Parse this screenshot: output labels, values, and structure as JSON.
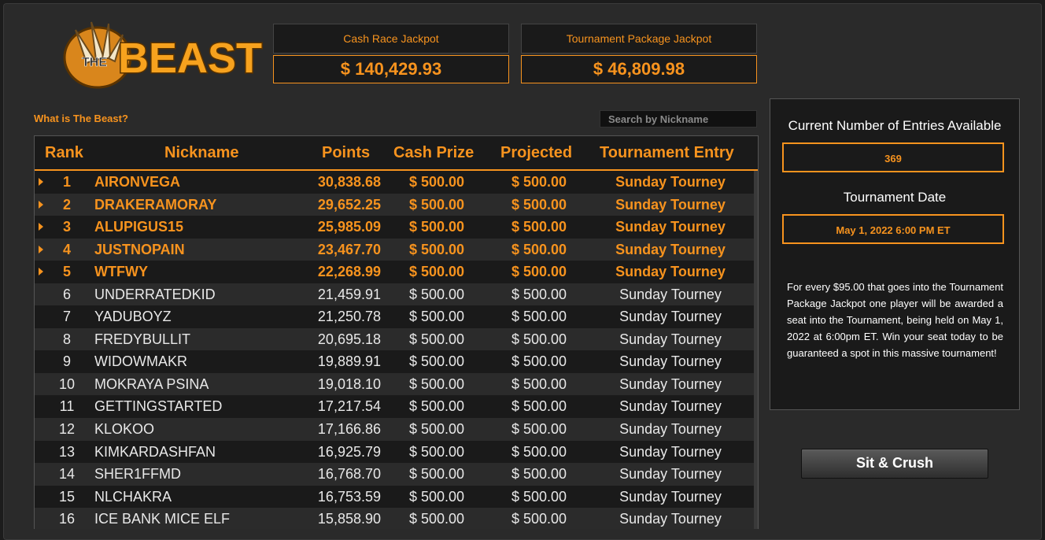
{
  "logo": {
    "text": "BEAST",
    "prefix": "THE"
  },
  "jackpots": [
    {
      "title": "Cash Race Jackpot",
      "value": "$ 140,429.93"
    },
    {
      "title": "Tournament Package Jackpot",
      "value": "$ 46,809.98"
    }
  ],
  "what_link": "What is The Beast?",
  "search": {
    "placeholder": "Search by Nickname"
  },
  "table": {
    "headers": {
      "rank": "Rank",
      "nickname": "Nickname",
      "points": "Points",
      "cash": "Cash Prize",
      "projected": "Projected",
      "tournament": "Tournament Entry"
    },
    "rows": [
      {
        "rank": "1",
        "nick": "AIRONVEGA",
        "points": "30,838.68",
        "cash": "$ 500.00",
        "proj": "$ 500.00",
        "tour": "Sunday Tourney"
      },
      {
        "rank": "2",
        "nick": "DRAKERAMORAY",
        "points": "29,652.25",
        "cash": "$ 500.00",
        "proj": "$ 500.00",
        "tour": "Sunday Tourney"
      },
      {
        "rank": "3",
        "nick": "ALUPIGUS15",
        "points": "25,985.09",
        "cash": "$ 500.00",
        "proj": "$ 500.00",
        "tour": "Sunday Tourney"
      },
      {
        "rank": "4",
        "nick": "JUSTNOPAIN",
        "points": "23,467.70",
        "cash": "$ 500.00",
        "proj": "$ 500.00",
        "tour": "Sunday Tourney"
      },
      {
        "rank": "5",
        "nick": "WTFWY",
        "points": "22,268.99",
        "cash": "$ 500.00",
        "proj": "$ 500.00",
        "tour": "Sunday Tourney"
      },
      {
        "rank": "6",
        "nick": "UNDERRATEDKID",
        "points": "21,459.91",
        "cash": "$ 500.00",
        "proj": "$ 500.00",
        "tour": "Sunday Tourney"
      },
      {
        "rank": "7",
        "nick": "YADUBOYZ",
        "points": "21,250.78",
        "cash": "$ 500.00",
        "proj": "$ 500.00",
        "tour": "Sunday Tourney"
      },
      {
        "rank": "8",
        "nick": "FREDYBULLIT",
        "points": "20,695.18",
        "cash": "$ 500.00",
        "proj": "$ 500.00",
        "tour": "Sunday Tourney"
      },
      {
        "rank": "9",
        "nick": "WIDOWMAKR",
        "points": "19,889.91",
        "cash": "$ 500.00",
        "proj": "$ 500.00",
        "tour": "Sunday Tourney"
      },
      {
        "rank": "10",
        "nick": "MOKRAYA PSINA",
        "points": "19,018.10",
        "cash": "$ 500.00",
        "proj": "$ 500.00",
        "tour": "Sunday Tourney"
      },
      {
        "rank": "11",
        "nick": "GETTINGSTARTED",
        "points": "17,217.54",
        "cash": "$ 500.00",
        "proj": "$ 500.00",
        "tour": "Sunday Tourney"
      },
      {
        "rank": "12",
        "nick": "KLOKOO",
        "points": "17,166.86",
        "cash": "$ 500.00",
        "proj": "$ 500.00",
        "tour": "Sunday Tourney"
      },
      {
        "rank": "13",
        "nick": "KIMKARDASHFAN",
        "points": "16,925.79",
        "cash": "$ 500.00",
        "proj": "$ 500.00",
        "tour": "Sunday Tourney"
      },
      {
        "rank": "14",
        "nick": "SHER1FFMD",
        "points": "16,768.70",
        "cash": "$ 500.00",
        "proj": "$ 500.00",
        "tour": "Sunday Tourney"
      },
      {
        "rank": "15",
        "nick": "NLCHAKRA",
        "points": "16,753.59",
        "cash": "$ 500.00",
        "proj": "$ 500.00",
        "tour": "Sunday Tourney"
      },
      {
        "rank": "16",
        "nick": "ICE BANK MICE ELF",
        "points": "15,858.90",
        "cash": "$ 500.00",
        "proj": "$ 500.00",
        "tour": "Sunday Tourney"
      }
    ]
  },
  "panel": {
    "entries_label": "Current Number of Entries Available",
    "entries_value": "369",
    "date_label": "Tournament Date",
    "date_value": "May 1, 2022 6:00 PM ET",
    "description": "For every $95.00 that goes into the Tournament Package Jackpot one player will be awarded a seat into the Tournament, being held on May 1, 2022 at 6:00pm ET. Win your seat today to be guaranteed a spot in this massive tournament!"
  },
  "sit_button": "Sit & Crush",
  "colors": {
    "accent": "#f7931e",
    "background": "#2a2a2a",
    "panel": "#1a1a1a"
  }
}
